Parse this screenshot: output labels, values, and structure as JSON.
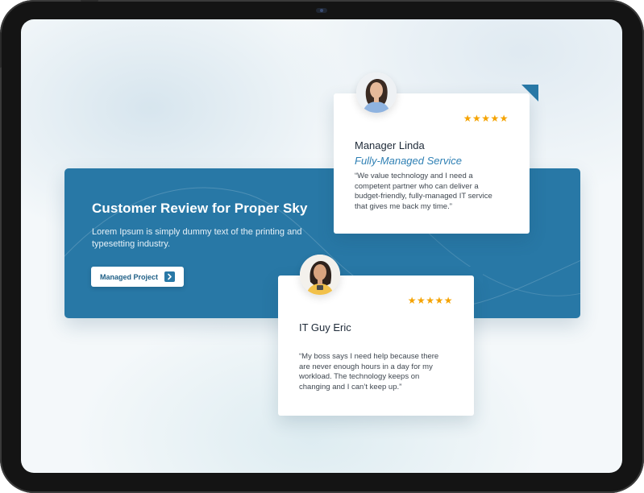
{
  "colors": {
    "device_frame": "#141414",
    "banner": "#2878a6",
    "accent_role": "#2f80b4",
    "star": "#f5a300",
    "card": "#ffffff"
  },
  "banner": {
    "title": "Customer Review for Proper Sky",
    "description": "Lorem Ipsum is simply dummy text of the printing and typesetting industry.",
    "cta_label": "Managed Project",
    "cta_icon": "chevron-right-icon"
  },
  "reviews": [
    {
      "stars": "★★★★★",
      "rating": 5,
      "name": "Manager Linda",
      "role": "Fully-Managed Service",
      "quote": "“We value technology and I need a competent partner who can deliver a budget-friendly, fully-managed IT service that gives me back my time.”"
    },
    {
      "stars": "★★★★★",
      "rating": 5,
      "name": "IT Guy Eric",
      "quote": "“My boss says I need help because there are never enough hours in a day for my workload. The technology keeps on changing and I can’t keep up.”"
    }
  ]
}
